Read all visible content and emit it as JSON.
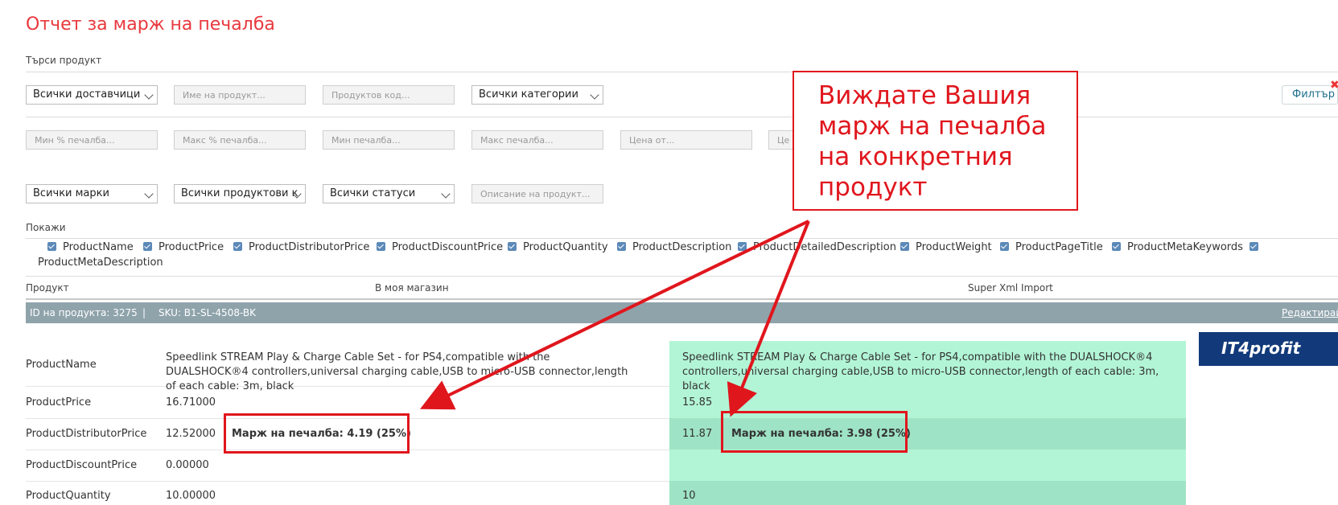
{
  "page_title": "Отчет за марж на печалба",
  "search_label": "Търси продукт",
  "filters_row1": {
    "suppliers": "Всички доставчици",
    "product_name_ph": "Име на продукт...",
    "product_code_ph": "Продуктов код...",
    "categories": "Всички категории",
    "filter_button": "Филтър"
  },
  "filters_row2": {
    "min_pct_ph": "Мин % печалба...",
    "max_pct_ph": "Макс % печалба...",
    "min_profit_ph": "Мин печалба...",
    "max_profit_ph": "Макс печалба...",
    "price_from_ph": "Цена от...",
    "price_to_ph": "Це"
  },
  "filters_row3": {
    "brands": "Всички марки",
    "product_types": "Всички продуктови к",
    "statuses": "Всички статуси",
    "description_ph": "Описание на продукт..."
  },
  "show_label": "Покажи",
  "show_checkboxes": [
    "ProductName",
    "ProductPrice",
    "ProductDistributorPrice",
    "ProductDiscountPrice",
    "ProductQuantity",
    "ProductDescription",
    "ProductDetailedDescription",
    "ProductWeight",
    "ProductPageTitle",
    "ProductMetaKeywords",
    "ProductMetaDescription"
  ],
  "columns": {
    "product": "Продукт",
    "my_store": "В моя магазин",
    "import": "Super Xml Import"
  },
  "product_bar": {
    "id_text": "ID на продукта: 3275",
    "separator": "|",
    "sku_text": "SKU: B1-SL-4508-BK",
    "edit_link": "Редактирай"
  },
  "rows": [
    {
      "field": "ProductName",
      "my_store": "Speedlink STREAM Play & Charge Cable Set - for PS4,compatible with the DUALSHOCK®4 controllers,universal charging cable,USB to micro-USB connector,length of each cable: 3m, black",
      "import": "Speedlink STREAM Play & Charge Cable Set - for PS4,compatible with the DUALSHOCK®4 controllers,universal charging cable,USB to micro-USB connector,length of each cable: 3m, black"
    },
    {
      "field": "ProductPrice",
      "my_store": "16.71000",
      "import": "15.85"
    },
    {
      "field": "ProductDistributorPrice",
      "my_store": "12.52000",
      "import": "11.87",
      "my_margin": "Марж на печалба: 4.19 (25%)",
      "import_margin": "Марж на печалба: 3.98 (25%)"
    },
    {
      "field": "ProductDiscountPrice",
      "my_store": "0.00000",
      "import": ""
    },
    {
      "field": "ProductQuantity",
      "my_store": "10.00000",
      "import": "10"
    }
  ],
  "callout_text": "Виждате Вашия марж на печалба на конкретния продукт",
  "logo_text": "IT4profit",
  "colors": {
    "title": "#e8383d",
    "annotation_red": "#e0161d",
    "bar": "#8fa3ab",
    "green_light": "#b2f5d6",
    "green_dark": "#9ee3c5"
  }
}
